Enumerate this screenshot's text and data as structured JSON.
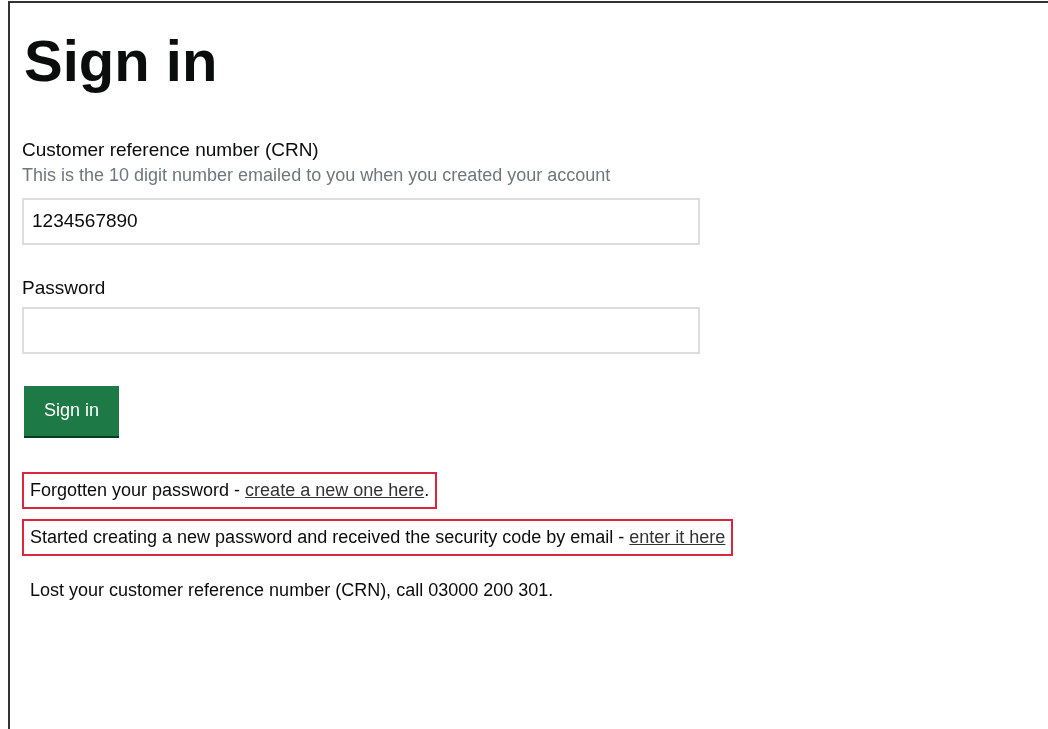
{
  "heading": "Sign in",
  "fields": [
    {
      "label": "Customer reference number (CRN)",
      "hint": "This is the 10 digit number emailed to you when you created your account",
      "value": "1234567890"
    },
    {
      "label": "Password"
    }
  ],
  "button": "Sign in",
  "help_lines": [
    {
      "text": "Forgotten your password - ",
      "link": "create a new one here",
      "after": ".",
      "highlighted": true
    },
    {
      "text": "Started creating a new password and received the security code by email - ",
      "link": "enter it here",
      "highlighted": true
    },
    {
      "text": "Lost your customer reference number (CRN), call 03000 200 301.",
      "highlighted": false
    }
  ]
}
